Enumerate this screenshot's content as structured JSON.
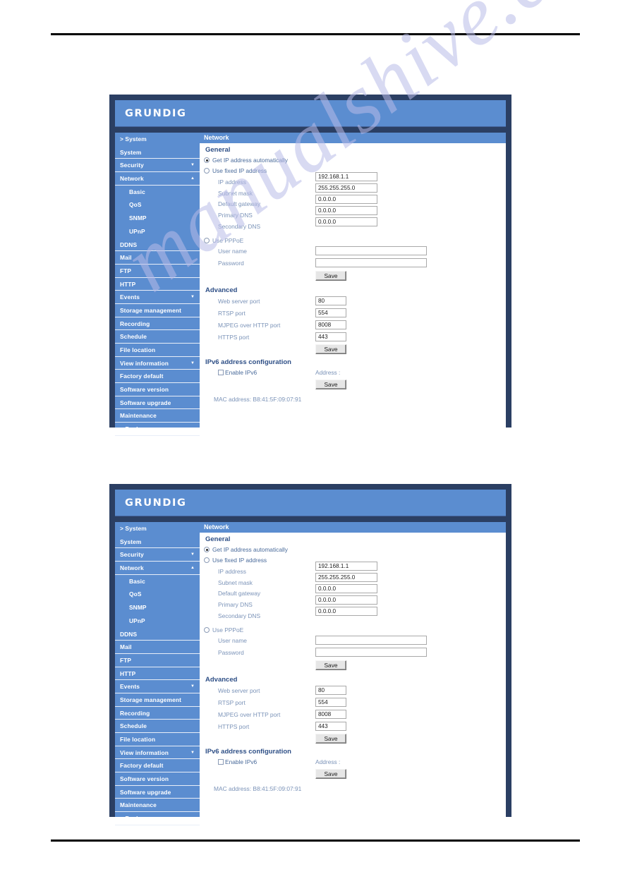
{
  "document": {
    "rules": [
      "top-rule",
      "bottom-rule"
    ],
    "watermark": "manualshive.com"
  },
  "panel": {
    "brand": "GRUNDIG",
    "page_title": "Network",
    "sidebar": [
      {
        "label": "> System",
        "type": "root",
        "arrow": ""
      },
      {
        "label": "System",
        "type": "item",
        "arrow": ""
      },
      {
        "label": "Security",
        "type": "item",
        "arrow": "▼"
      },
      {
        "label": "Network",
        "type": "item",
        "arrow": "▲"
      },
      {
        "label": "Basic",
        "type": "sub",
        "arrow": ""
      },
      {
        "label": "QoS",
        "type": "sub",
        "arrow": ""
      },
      {
        "label": "SNMP",
        "type": "sub",
        "arrow": ""
      },
      {
        "label": "UPnP",
        "type": "sub",
        "arrow": ""
      },
      {
        "label": "DDNS",
        "type": "item",
        "arrow": ""
      },
      {
        "label": "Mail",
        "type": "item",
        "arrow": ""
      },
      {
        "label": "FTP",
        "type": "item",
        "arrow": ""
      },
      {
        "label": "HTTP",
        "type": "item",
        "arrow": ""
      },
      {
        "label": "Events",
        "type": "item",
        "arrow": "▼"
      },
      {
        "label": "Storage management",
        "type": "item",
        "arrow": ""
      },
      {
        "label": "Recording",
        "type": "item",
        "arrow": ""
      },
      {
        "label": "Schedule",
        "type": "item",
        "arrow": ""
      },
      {
        "label": "File location",
        "type": "item",
        "arrow": ""
      },
      {
        "label": "View information",
        "type": "item",
        "arrow": "▼"
      },
      {
        "label": "Factory default",
        "type": "item",
        "arrow": ""
      },
      {
        "label": "Software version",
        "type": "item",
        "arrow": ""
      },
      {
        "label": "Software upgrade",
        "type": "item",
        "arrow": ""
      },
      {
        "label": "Maintenance",
        "type": "item",
        "arrow": ""
      },
      {
        "label": "< Back",
        "type": "item",
        "arrow": ""
      }
    ],
    "general": {
      "heading": "General",
      "radio_auto_label": "Get IP address automatically",
      "radio_auto_selected": true,
      "radio_fixed_label": "Use fixed IP address",
      "radio_fixed_selected": false,
      "fields": [
        {
          "label": "IP address",
          "value": "192.168.1.1"
        },
        {
          "label": "Subnet mask",
          "value": "255.255.255.0"
        },
        {
          "label": "Default gateway",
          "value": "0.0.0.0"
        },
        {
          "label": "Primary DNS",
          "value": "0.0.0.0"
        },
        {
          "label": "Secondary DNS",
          "value": "0.0.0.0"
        }
      ],
      "radio_pppoe_label": "Use PPPoE",
      "radio_pppoe_selected": false,
      "pppoe_fields": [
        {
          "label": "User name",
          "value": ""
        },
        {
          "label": "Password",
          "value": ""
        }
      ],
      "save_label": "Save"
    },
    "advanced": {
      "heading": "Advanced",
      "fields": [
        {
          "label": "Web server port",
          "value": "80"
        },
        {
          "label": "RTSP port",
          "value": "554"
        },
        {
          "label": "MJPEG over HTTP port",
          "value": "8008"
        },
        {
          "label": "HTTPS port",
          "value": "443"
        }
      ],
      "save_label": "Save"
    },
    "ipv6": {
      "heading": "IPv6 address configuration",
      "enable_label": "Enable IPv6",
      "enable_checked": false,
      "address_label": "Address :",
      "save_label": "Save"
    },
    "mac": "MAC address: B8:41:5F:09:07:91"
  }
}
